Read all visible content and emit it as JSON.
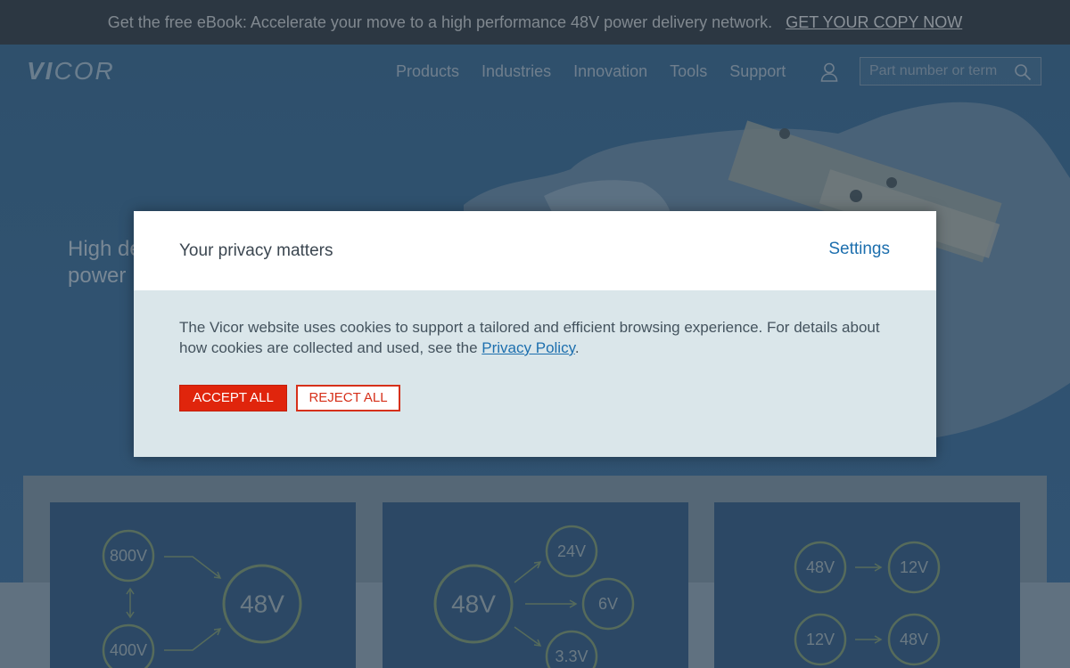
{
  "promo": {
    "text": "Get the free eBook: Accelerate your move to a high performance 48V power delivery network.",
    "link": "GET YOUR COPY NOW"
  },
  "header": {
    "logo_bold": "VI",
    "logo_rest": "COR",
    "nav": [
      "Products",
      "Industries",
      "Innovation",
      "Tools",
      "Support"
    ],
    "search_placeholder": "Part number or term"
  },
  "hero": {
    "line1": "High de",
    "line2": "power"
  },
  "cards": [
    {
      "labels": [
        "800V",
        "400V",
        "48V"
      ]
    },
    {
      "labels": [
        "48V",
        "24V",
        "6V",
        "3.3V"
      ]
    },
    {
      "labels": [
        "48V",
        "12V",
        "12V",
        "48V"
      ]
    }
  ],
  "dialog": {
    "title": "Your privacy matters",
    "settings": "Settings",
    "body_text": "The Vicor website uses cookies to support a tailored and efficient browsing experience. For details about how cookies are collected and used, see the",
    "policy_link": "Privacy Policy",
    "body_end": ".",
    "accept": "ACCEPT ALL",
    "reject": "REJECT ALL"
  },
  "colors": {
    "accent_red": "#e0250c",
    "link_blue": "#1d6fae",
    "dialog_body_bg": "#dae6ea"
  }
}
